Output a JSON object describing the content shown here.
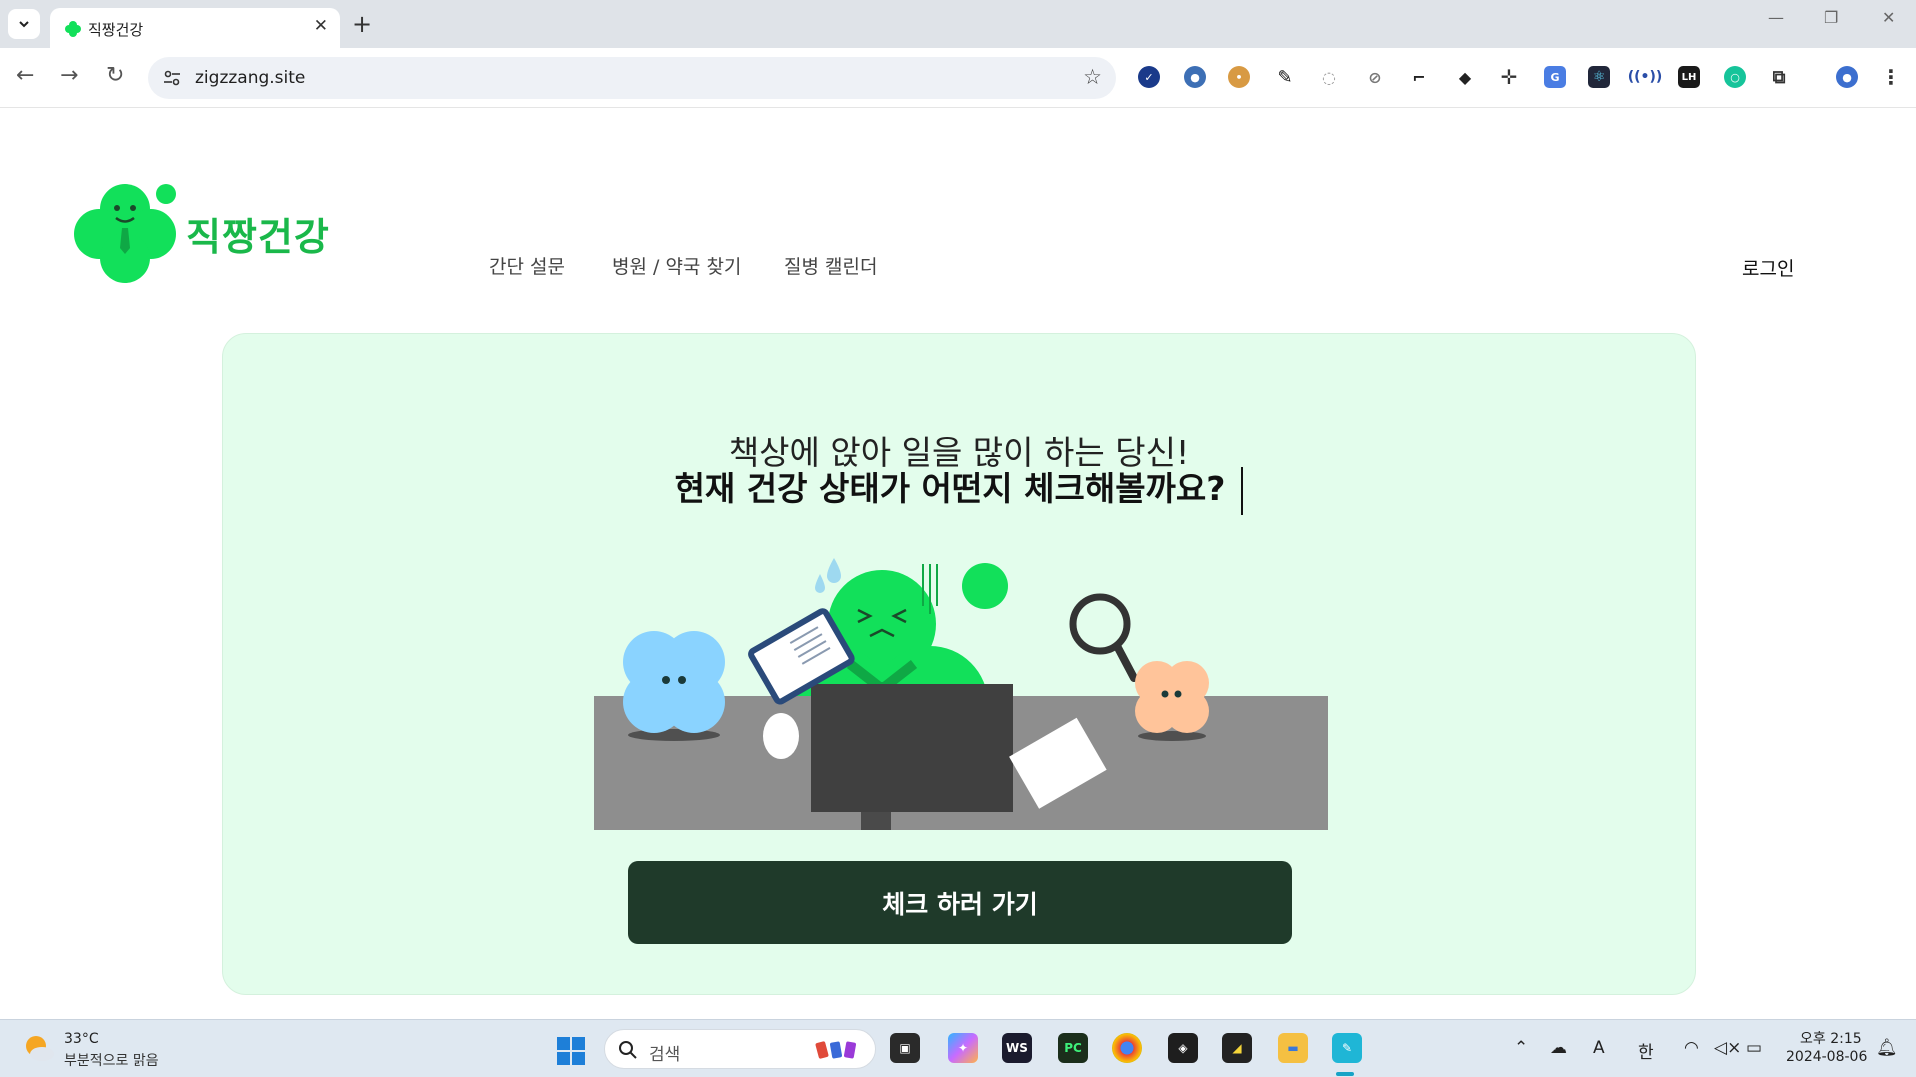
{
  "browser": {
    "tab_title": "직짱건강",
    "url": "zigzzang.site",
    "colors": {
      "tabbar": "#dfe3e8",
      "omnibox": "#eef1f6"
    },
    "extension_icons": [
      "checkmark-icon",
      "avatar-icon",
      "cookie-icon",
      "eyedropper-icon",
      "circle-icon",
      "compass-icon",
      "ruler-icon",
      "incognito-icon",
      "crosshair-icon",
      "translate-icon",
      "react-icon",
      "wave-icon",
      "lh-icon",
      "chat-icon",
      "puzzle-icon",
      "profile-icon",
      "kebab-menu-icon"
    ],
    "extension_labels": {
      "lh": "LH"
    }
  },
  "site": {
    "logo_text": "직짱건강",
    "nav": [
      "간단 설문",
      "병원 / 약국 찾기",
      "질병 캘린더"
    ],
    "login": "로그인"
  },
  "hero": {
    "line1": "책상에 앉아 일을 많이 하는 당신!",
    "line2": "현재 건강 상태가 어떤지 체크해볼까요?",
    "cta": "체크 하러 가기",
    "colors": {
      "background": "#e3fdec",
      "cta": "#1f3a2a",
      "brand_green": "#1ab84a"
    }
  },
  "taskbar": {
    "temperature": "33°C",
    "weather": "부분적으로 맑음",
    "search_placeholder": "검색",
    "app_labels": {
      "ws": "WS",
      "pc": "PC"
    },
    "ime": "한",
    "font_indicator": "A",
    "time": "오후 2:15",
    "date": "2024-08-06"
  }
}
